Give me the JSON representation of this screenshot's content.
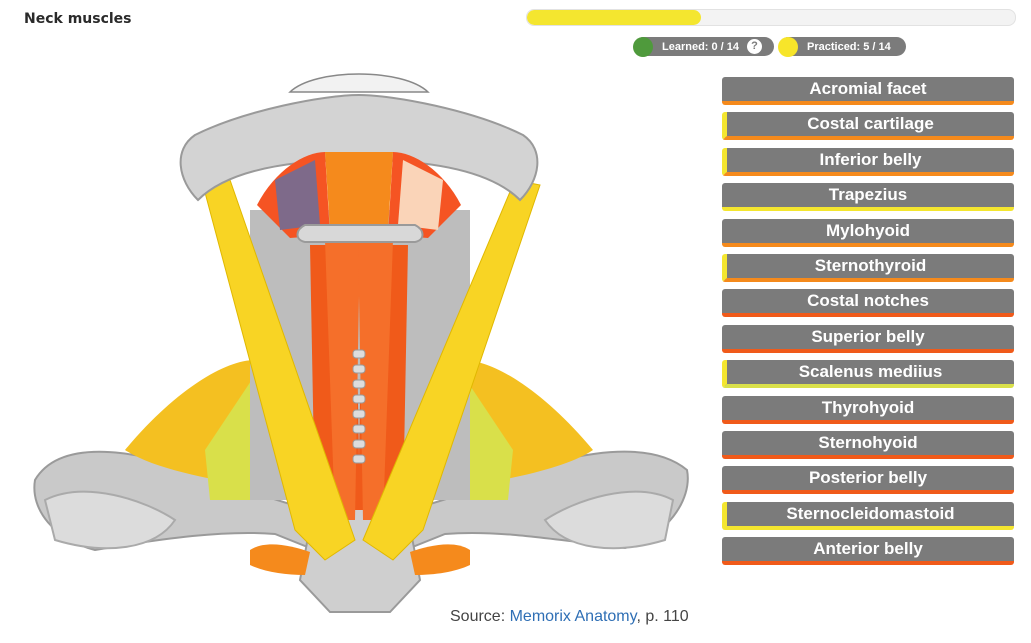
{
  "title": "Neck muscles",
  "progress": {
    "practiced_fraction": 0.357
  },
  "stats": {
    "learned_label": "Learned: 0 / 14",
    "practiced_label": "Practiced: 5 / 14",
    "learned_color": "#4f9a3c",
    "practiced_color": "#f7e52a",
    "help_icon": "?"
  },
  "terms": [
    {
      "label": "Acromial facet",
      "marked": false,
      "color": "#f58a1c"
    },
    {
      "label": "Costal cartilage",
      "marked": true,
      "color": "#f58a1c"
    },
    {
      "label": "Inferior belly",
      "marked": true,
      "color": "#f58a1c"
    },
    {
      "label": "Trapezius",
      "marked": false,
      "color": "#f4e62f"
    },
    {
      "label": "Mylohyoid",
      "marked": false,
      "color": "#f58a1c"
    },
    {
      "label": "Sternothyroid",
      "marked": true,
      "color": "#f58a1c"
    },
    {
      "label": "Costal notches",
      "marked": false,
      "color": "#f05a1a"
    },
    {
      "label": "Superior belly",
      "marked": false,
      "color": "#f05a1a"
    },
    {
      "label": "Scalenus mediius",
      "marked": true,
      "color": "#d9e04a"
    },
    {
      "label": "Thyrohyoid",
      "marked": false,
      "color": "#f05a1a"
    },
    {
      "label": "Sternohyoid",
      "marked": false,
      "color": "#f05a1a"
    },
    {
      "label": "Posterior belly",
      "marked": false,
      "color": "#f05a1a"
    },
    {
      "label": "Sternocleidomastoid",
      "marked": true,
      "color": "#f4e62f"
    },
    {
      "label": "Anterior belly",
      "marked": false,
      "color": "#f05a1a"
    }
  ],
  "source": {
    "prefix": "Source: ",
    "link_text": "Memorix Anatomy",
    "suffix": ", p. 110"
  }
}
